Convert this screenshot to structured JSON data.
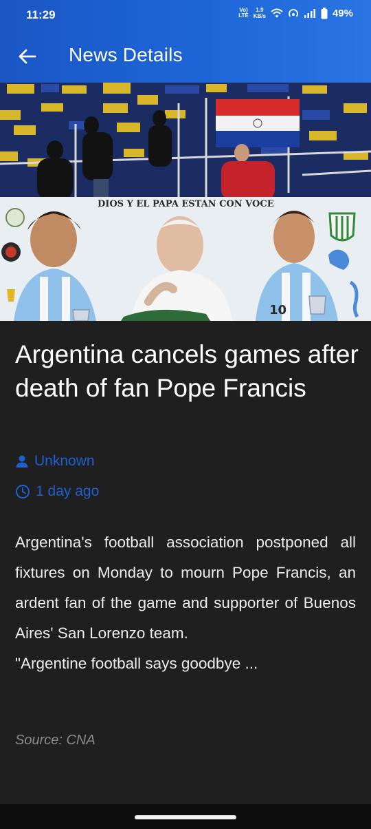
{
  "status_bar": {
    "time": "11:29",
    "volte_line1": "Vo)",
    "volte_line2": "LTE",
    "net_speed_value": "1.9",
    "net_speed_unit": "KB/s",
    "battery": "49%",
    "icons": [
      "volte-icon",
      "wifi-icon",
      "hotspot-icon",
      "signal-icon",
      "battery-icon"
    ]
  },
  "app_bar": {
    "title": "News Details",
    "back_icon": "arrow-left-icon"
  },
  "hero": {
    "banner_text": "DIOS Y EL PAPA ESTAN CON VOCE",
    "jersey_number": "10",
    "colors": {
      "stadium_blue": "#12265a",
      "seat_yellow": "#e2c02a",
      "banner_bg": "#e9eef3"
    }
  },
  "article": {
    "title": "Argentina cancels games after death of fan Pope Francis",
    "author": "Unknown",
    "published": "1 day ago",
    "body_p1": "Argentina's football association postponed all fixtures on Monday to mourn Pope Francis, an ardent fan of the game and supporter of Buenos Aires' San Lorenzo team.",
    "body_p2": "\"Argentine football says goodbye ...",
    "source": "Source: CNA"
  },
  "theme": {
    "accent": "#1f5fd0",
    "background": "#1f1f1f",
    "appbar": "#1e66d8"
  }
}
